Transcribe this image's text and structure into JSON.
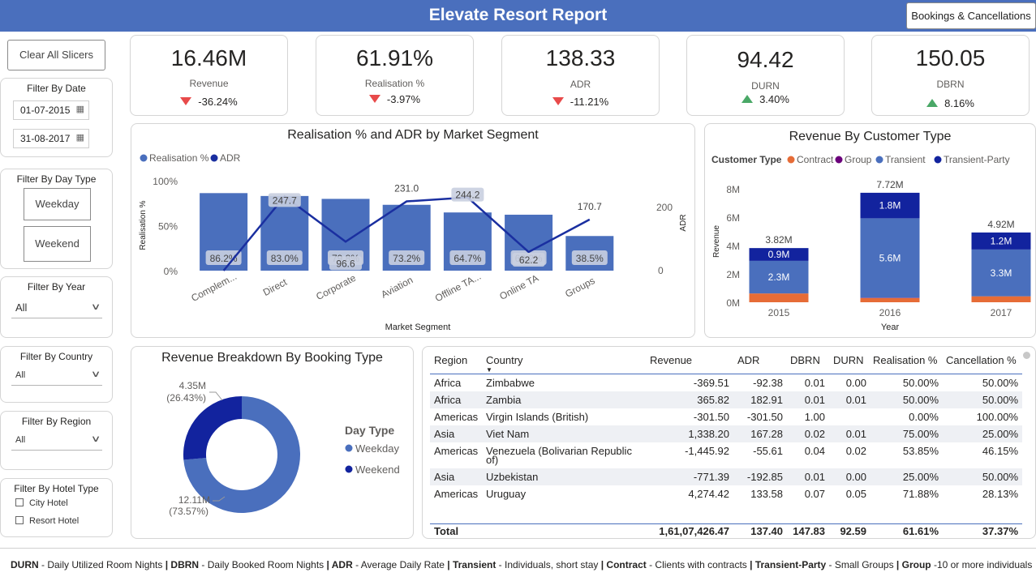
{
  "header": {
    "title": "Elevate Resort Report",
    "nav_button": "Bookings & Cancellations"
  },
  "slicers": {
    "clear_label": "Clear All Slicers",
    "date": {
      "title": "Filter By Date",
      "start": "01-07-2015",
      "end": "31-08-2017"
    },
    "day_type": {
      "title": "Filter By Day Type",
      "options": [
        "Weekday",
        "Weekend"
      ]
    },
    "year": {
      "title": "Filter By Year",
      "value": "All"
    },
    "country": {
      "title": "Filter By Country",
      "value": "All"
    },
    "region": {
      "title": "Filter By Region",
      "value": "All"
    },
    "hotel_type": {
      "title": "Filter By Hotel Type",
      "options": [
        "City Hotel",
        "Resort Hotel"
      ]
    }
  },
  "kpis": [
    {
      "value": "16.46M",
      "label": "Revenue",
      "delta": "-36.24%",
      "direction": "down"
    },
    {
      "value": "61.91%",
      "label": "Realisation %",
      "delta": "-3.97%",
      "direction": "down"
    },
    {
      "value": "138.33",
      "label": "ADR",
      "delta": "-11.21%",
      "direction": "down"
    },
    {
      "value": "94.42",
      "label": "DURN",
      "delta": "3.40%",
      "direction": "up"
    },
    {
      "value": "150.05",
      "label": "DBRN",
      "delta": "8.16%",
      "direction": "up"
    }
  ],
  "chart_data": [
    {
      "type": "bar",
      "title": "Realisation % and ADR by Market Segment",
      "xlabel": "Market Segment",
      "ylabel": "Realisation %",
      "y2label": "ADR",
      "legend": [
        "Realisation %",
        "ADR"
      ],
      "categories": [
        "Complem...",
        "Direct",
        "Corporate",
        "Aviation",
        "Offline TA...",
        "Online TA",
        "Groups"
      ],
      "yticks": [
        "100%",
        "50%",
        "0%"
      ],
      "y2ticks": [
        "200",
        "0"
      ],
      "ylim": [
        0,
        100
      ],
      "y2lim": [
        0,
        300
      ],
      "series": [
        {
          "name": "Realisation %",
          "values": [
            86.2,
            83.0,
            79.8,
            73.2,
            64.7,
            62.2,
            38.5
          ],
          "labels": [
            "86.2%",
            "83.0%",
            "79.8%",
            "73.2%",
            "64.7%",
            "62.2%",
            "38.5%"
          ],
          "color": "#4a6fbd"
        },
        {
          "name": "ADR",
          "values": [
            0,
            247.7,
            96.6,
            231.0,
            244.2,
            62.2,
            170.7
          ],
          "labels": [
            "",
            "247.7",
            "96.6",
            "231.0",
            "244.2",
            "62.2",
            "170.7"
          ],
          "color": "#1a2fa0"
        }
      ]
    },
    {
      "type": "bar",
      "title": "Revenue By Customer Type",
      "xlabel": "Year",
      "ylabel": "Revenue",
      "legend_title": "Customer Type",
      "legend": [
        "Contract",
        "Group",
        "Transient",
        "Transient-Party"
      ],
      "categories": [
        "2015",
        "2016",
        "2017"
      ],
      "yticks": [
        "8M",
        "6M",
        "4M",
        "2M",
        "0M"
      ],
      "ylim": [
        0,
        8
      ],
      "totals": [
        "3.82M",
        "7.72M",
        "4.92M"
      ],
      "series": [
        {
          "name": "Contract",
          "values": [
            0.62,
            0.3,
            0.42
          ],
          "color": "#e66c37"
        },
        {
          "name": "Group",
          "values": [
            0.0,
            0.02,
            0.0
          ],
          "color": "#6b007b"
        },
        {
          "name": "Transient",
          "values": [
            2.3,
            5.6,
            3.3
          ],
          "labels": [
            "2.3M",
            "5.6M",
            "3.3M"
          ],
          "color": "#4a6fbd"
        },
        {
          "name": "Transient-Party",
          "values": [
            0.9,
            1.8,
            1.2
          ],
          "labels": [
            "0.9M",
            "1.8M",
            "1.2M"
          ],
          "color": "#12239e"
        }
      ]
    },
    {
      "type": "pie",
      "title": "Revenue Breakdown By Booking Type",
      "legend_title": "Day Type",
      "legend": [
        "Weekday",
        "Weekend"
      ],
      "series": [
        {
          "name": "Weekday",
          "value": 12.11,
          "label": "12.11M",
          "pct": "(73.57%)",
          "color": "#4a6fbd"
        },
        {
          "name": "Weekend",
          "value": 4.35,
          "label": "4.35M",
          "pct": "(26.43%)",
          "color": "#12239e"
        }
      ]
    }
  ],
  "table": {
    "columns": [
      "Region",
      "Country",
      "Revenue",
      "ADR",
      "DBRN",
      "DURN",
      "Realisation %",
      "Cancellation %"
    ],
    "rows": [
      [
        "Africa",
        "Zimbabwe",
        "-369.51",
        "-92.38",
        "0.01",
        "0.00",
        "50.00%",
        "50.00%"
      ],
      [
        "Africa",
        "Zambia",
        "365.82",
        "182.91",
        "0.01",
        "0.01",
        "50.00%",
        "50.00%"
      ],
      [
        "Americas",
        "Virgin Islands (British)",
        "-301.50",
        "-301.50",
        "1.00",
        "",
        "0.00%",
        "100.00%"
      ],
      [
        "Asia",
        "Viet Nam",
        "1,338.20",
        "167.28",
        "0.02",
        "0.01",
        "75.00%",
        "25.00%"
      ],
      [
        "Americas",
        "Venezuela (Bolivarian Republic",
        "-1,445.92",
        "-55.61",
        "0.04",
        "0.02",
        "53.85%",
        "46.15%"
      ],
      [
        "",
        "of)",
        "",
        "",
        "",
        "",
        "",
        ""
      ],
      [
        "Asia",
        "Uzbekistan",
        "-771.39",
        "-192.85",
        "0.01",
        "0.00",
        "25.00%",
        "50.00%"
      ],
      [
        "Americas",
        "Uruguay",
        "4,274.42",
        "133.58",
        "0.07",
        "0.05",
        "71.88%",
        "28.13%"
      ]
    ],
    "total": [
      "Total",
      "",
      "1,61,07,426.47",
      "137.40",
      "147.83",
      "92.59",
      "61.61%",
      "37.37%"
    ]
  },
  "footer": [
    {
      "term": "DURN",
      "desc": " - Daily Utilized Room Nights "
    },
    {
      "term": "DBRN",
      "desc": " - Daily Booked Room Nights "
    },
    {
      "term": "ADR",
      "desc": " - Average Daily Rate "
    },
    {
      "term": "Transient",
      "desc": " - Individuals, short stay "
    },
    {
      "term": "Contract",
      "desc": " - Clients with contracts "
    },
    {
      "term": "Transient-Party",
      "desc": " - Small Groups "
    },
    {
      "term": "Group",
      "desc": " -10 or more individuals"
    }
  ]
}
